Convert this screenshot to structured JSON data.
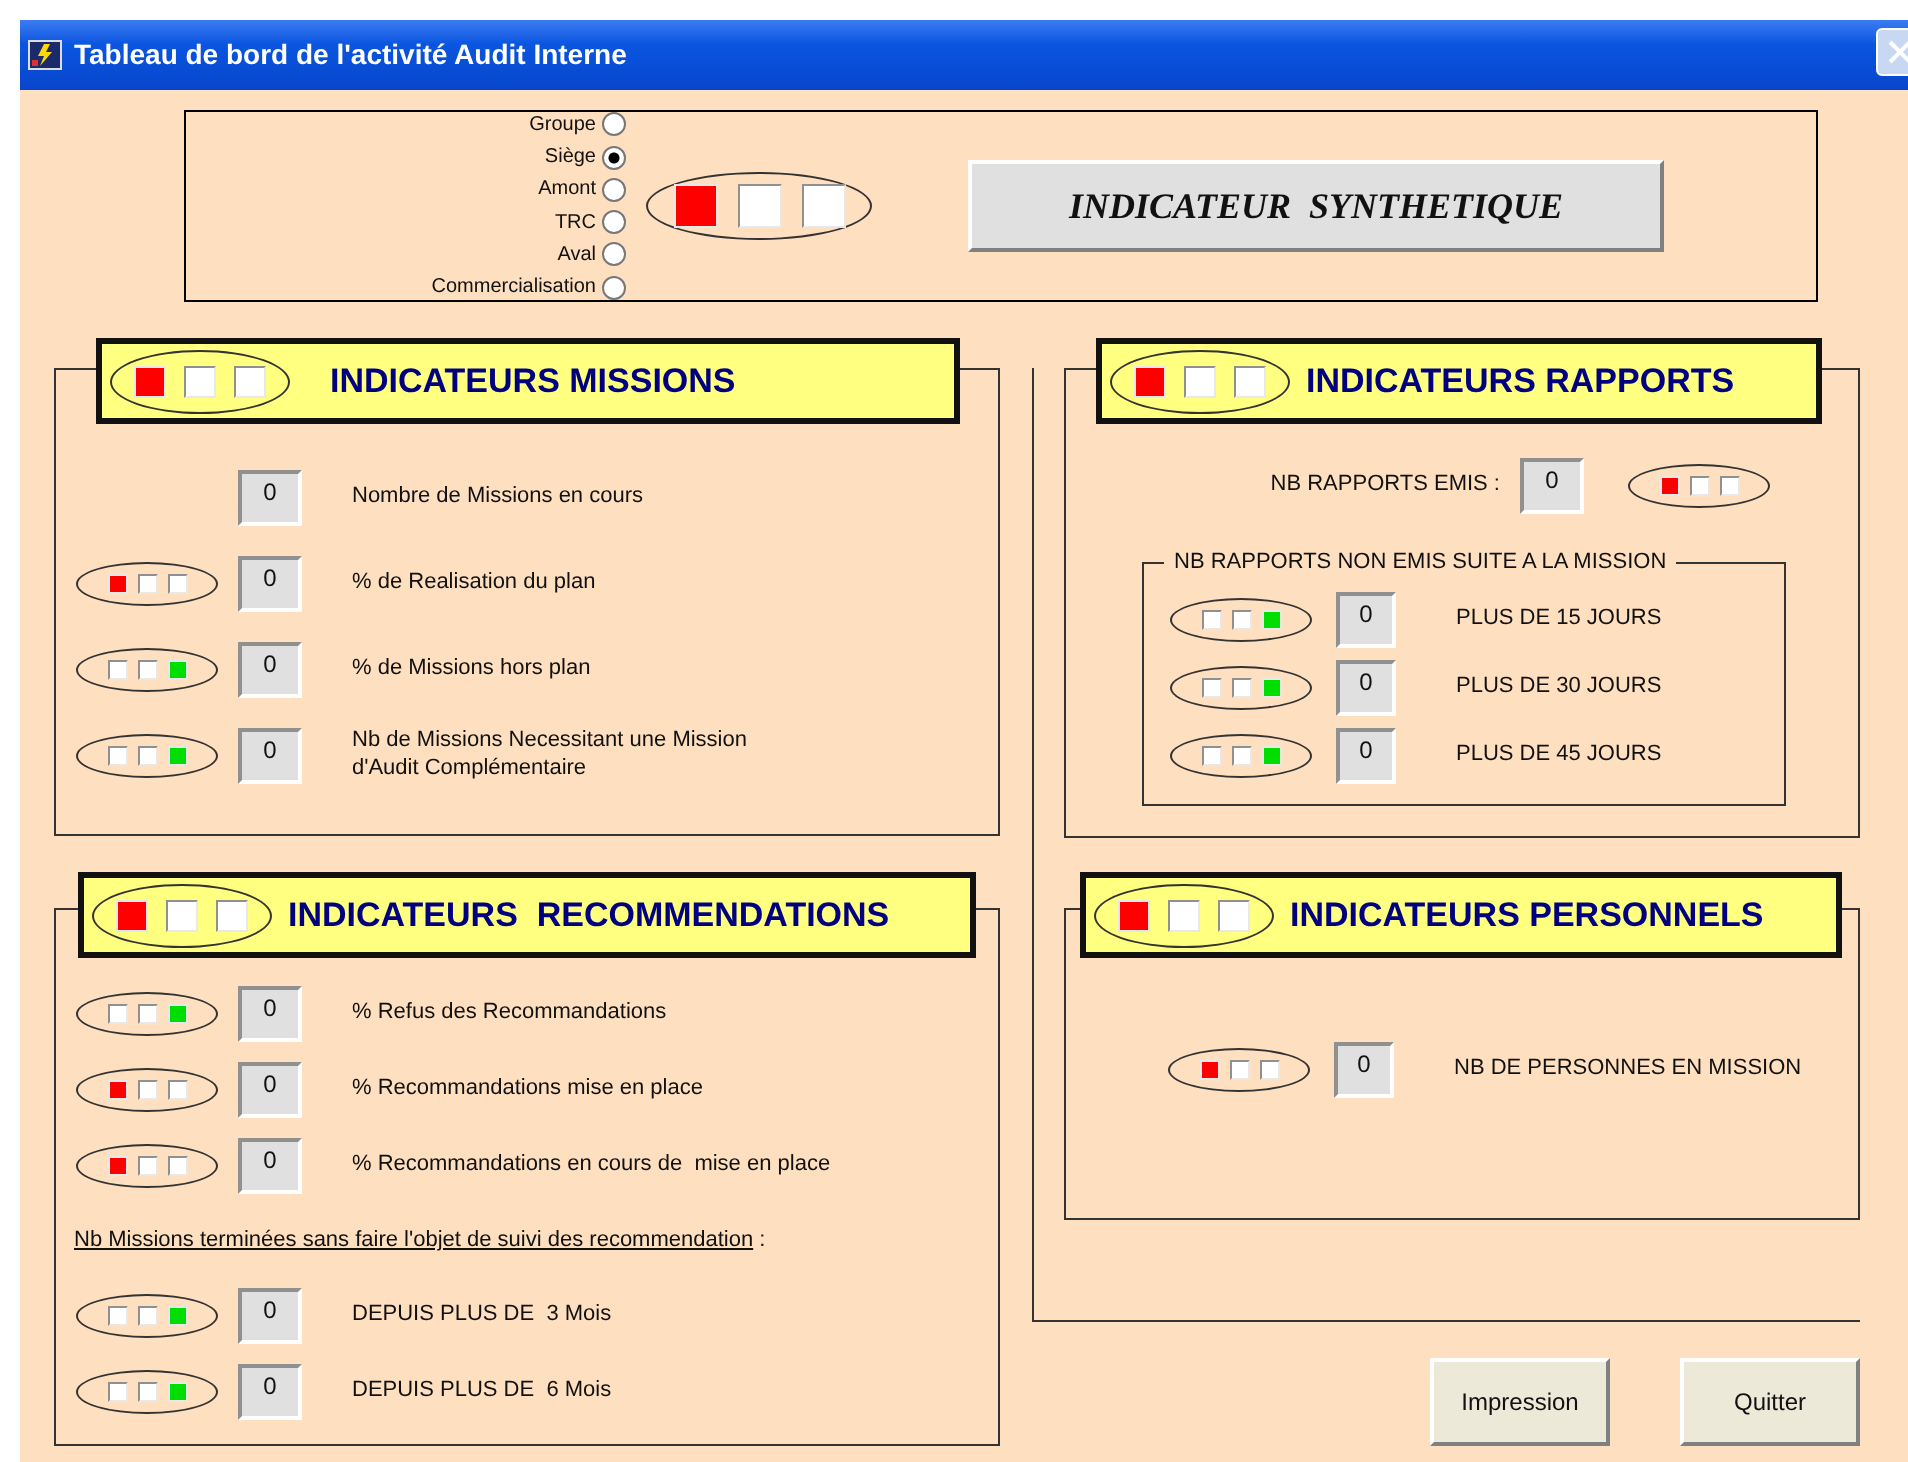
{
  "window": {
    "title": "Tableau de bord de l'activité Audit Interne"
  },
  "scope": {
    "options": [
      {
        "label": "Groupe",
        "selected": false
      },
      {
        "label": "Siège",
        "selected": true
      },
      {
        "label": "Amont",
        "selected": false
      },
      {
        "label": "TRC",
        "selected": false
      },
      {
        "label": "Aval",
        "selected": false
      },
      {
        "label": "Commercialisation",
        "selected": false
      }
    ],
    "signal": {
      "red": true,
      "amber": false,
      "green": false
    },
    "button": "INDICATEUR  SYNTHETIQUE"
  },
  "missions": {
    "title": "INDICATEURS MISSIONS",
    "signal": {
      "red": true,
      "amber": false,
      "green": false
    },
    "rows": [
      {
        "value": "0",
        "label": "Nombre de Missions en cours"
      },
      {
        "signal": {
          "red": true,
          "amber": false,
          "green": false
        },
        "value": "0",
        "label": "% de Realisation du plan"
      },
      {
        "signal": {
          "red": false,
          "amber": false,
          "green": true
        },
        "value": "0",
        "label": "% de Missions hors plan"
      },
      {
        "signal": {
          "red": false,
          "amber": false,
          "green": true
        },
        "value": "0",
        "label": "Nb de Missions Necessitant une Mission d'Audit Complémentaire"
      }
    ]
  },
  "recommandations": {
    "title": "INDICATEURS  RECOMMENDATIONS",
    "signal": {
      "red": true,
      "amber": false,
      "green": false
    },
    "rows": [
      {
        "kind": "indicator",
        "signal": {
          "red": false,
          "amber": false,
          "green": true
        },
        "value": "0",
        "label": "% Refus des Recommandations"
      },
      {
        "kind": "indicator",
        "signal": {
          "red": true,
          "amber": false,
          "green": false
        },
        "value": "0",
        "label": "% Recommandations mise en place"
      },
      {
        "kind": "indicator",
        "signal": {
          "red": true,
          "amber": false,
          "green": false
        },
        "value": "0",
        "label": "% Recommandations en cours de  mise en place"
      },
      {
        "kind": "note",
        "text": "Nb Missions terminées sans faire l'objet de suivi des recommendation",
        "suffix": ":"
      },
      {
        "kind": "indicator",
        "signal": {
          "red": false,
          "amber": false,
          "green": true
        },
        "value": "0",
        "label": "DEPUIS PLUS DE  3 Mois"
      },
      {
        "kind": "indicator",
        "signal": {
          "red": false,
          "amber": false,
          "green": true
        },
        "value": "0",
        "label": "DEPUIS PLUS DE  6 Mois"
      }
    ]
  },
  "rapports": {
    "title": "INDICATEURS RAPPORTS",
    "signal": {
      "red": true,
      "amber": false,
      "green": false
    },
    "emis": {
      "label": "NB RAPPORTS EMIS :",
      "value": "0",
      "signal": {
        "red": true,
        "amber": false,
        "green": false
      }
    },
    "non_emis": {
      "title": "NB RAPPORTS NON EMIS SUITE A LA MISSION",
      "rows": [
        {
          "signal": {
            "red": false,
            "amber": false,
            "green": true
          },
          "value": "0",
          "label": "PLUS DE 15 JOURS"
        },
        {
          "signal": {
            "red": false,
            "amber": false,
            "green": true
          },
          "value": "0",
          "label": "PLUS DE 30 JOURS"
        },
        {
          "signal": {
            "red": false,
            "amber": false,
            "green": true
          },
          "value": "0",
          "label": "PLUS DE 45 JOURS"
        }
      ]
    }
  },
  "personnels": {
    "title": "INDICATEURS PERSONNELS",
    "signal": {
      "red": true,
      "amber": false,
      "green": false
    },
    "rows": [
      {
        "signal": {
          "red": true,
          "amber": false,
          "green": false
        },
        "value": "0",
        "label": "NB DE PERSONNES EN MISSION"
      }
    ]
  },
  "buttons": [
    "Impression",
    "Quitter"
  ]
}
